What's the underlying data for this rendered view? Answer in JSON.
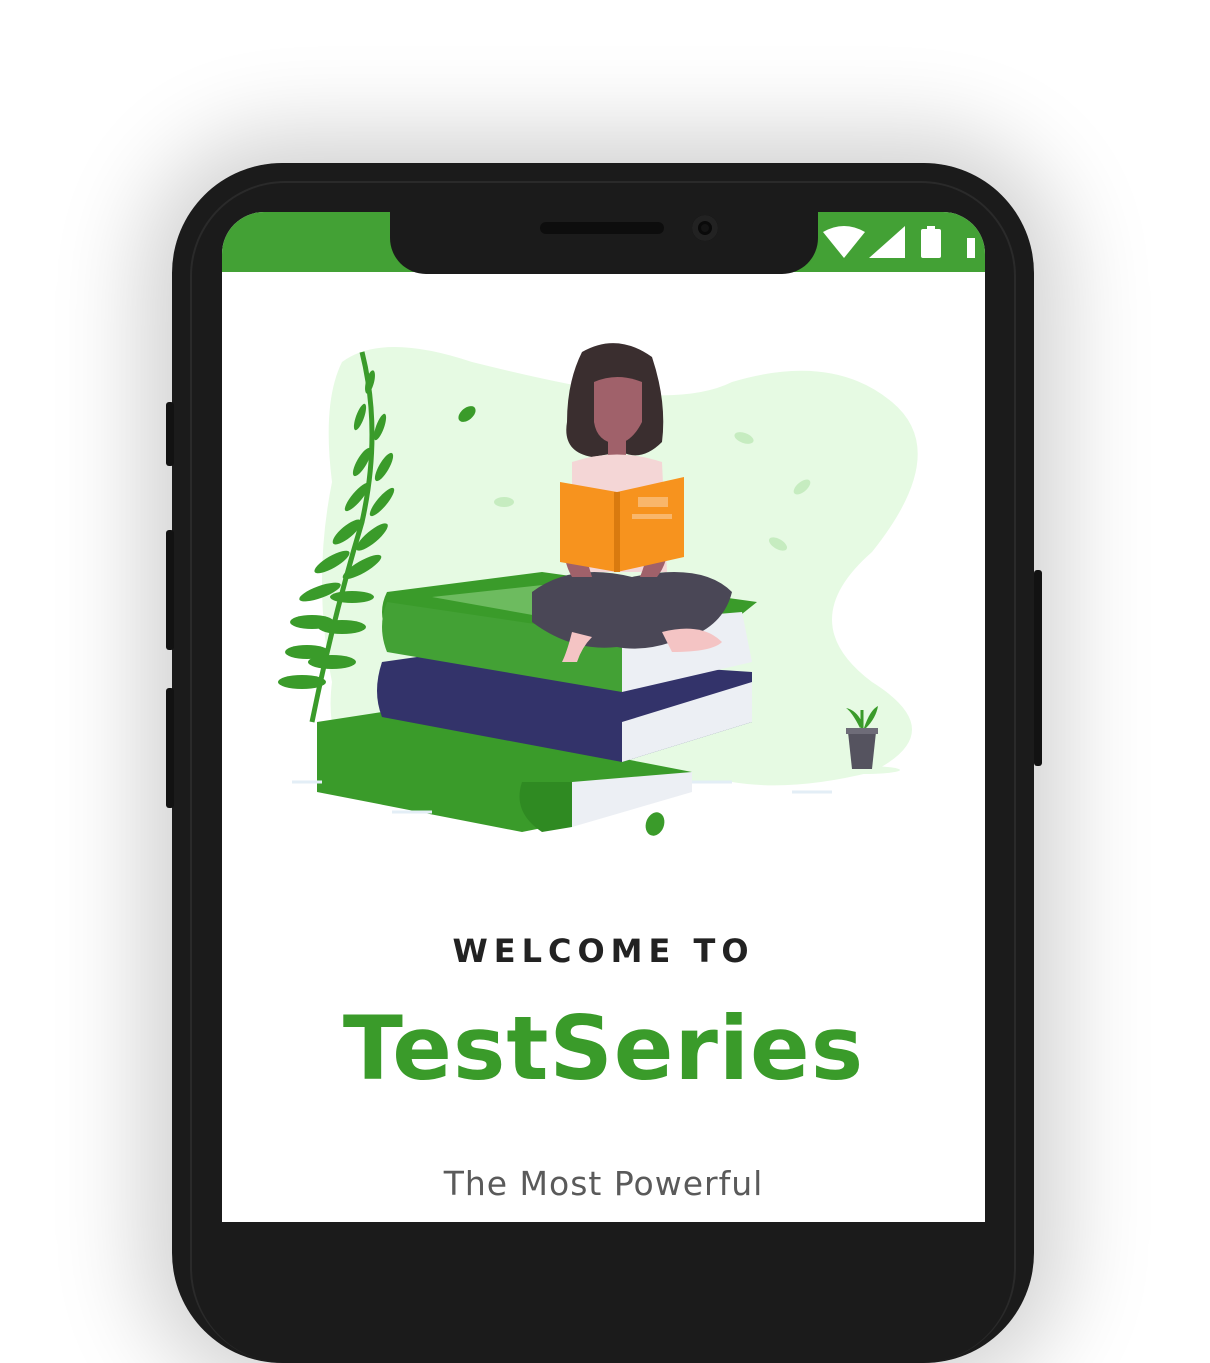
{
  "welcome_text": "WELCOME TO",
  "app_name": "TestSeries",
  "tagline": "The Most Powerful",
  "colors": {
    "status_bar": "#43a135",
    "brand_green": "#3a9b2a",
    "phone_frame": "#1b1b1b"
  },
  "status_bar": {
    "icons": [
      "wifi-icon",
      "signal-icon",
      "battery-icon"
    ]
  },
  "illustration": {
    "name": "woman-reading-on-books",
    "elements": [
      "plant-branch",
      "woman",
      "open-book",
      "book-stack",
      "potted-plant",
      "leaves"
    ]
  }
}
